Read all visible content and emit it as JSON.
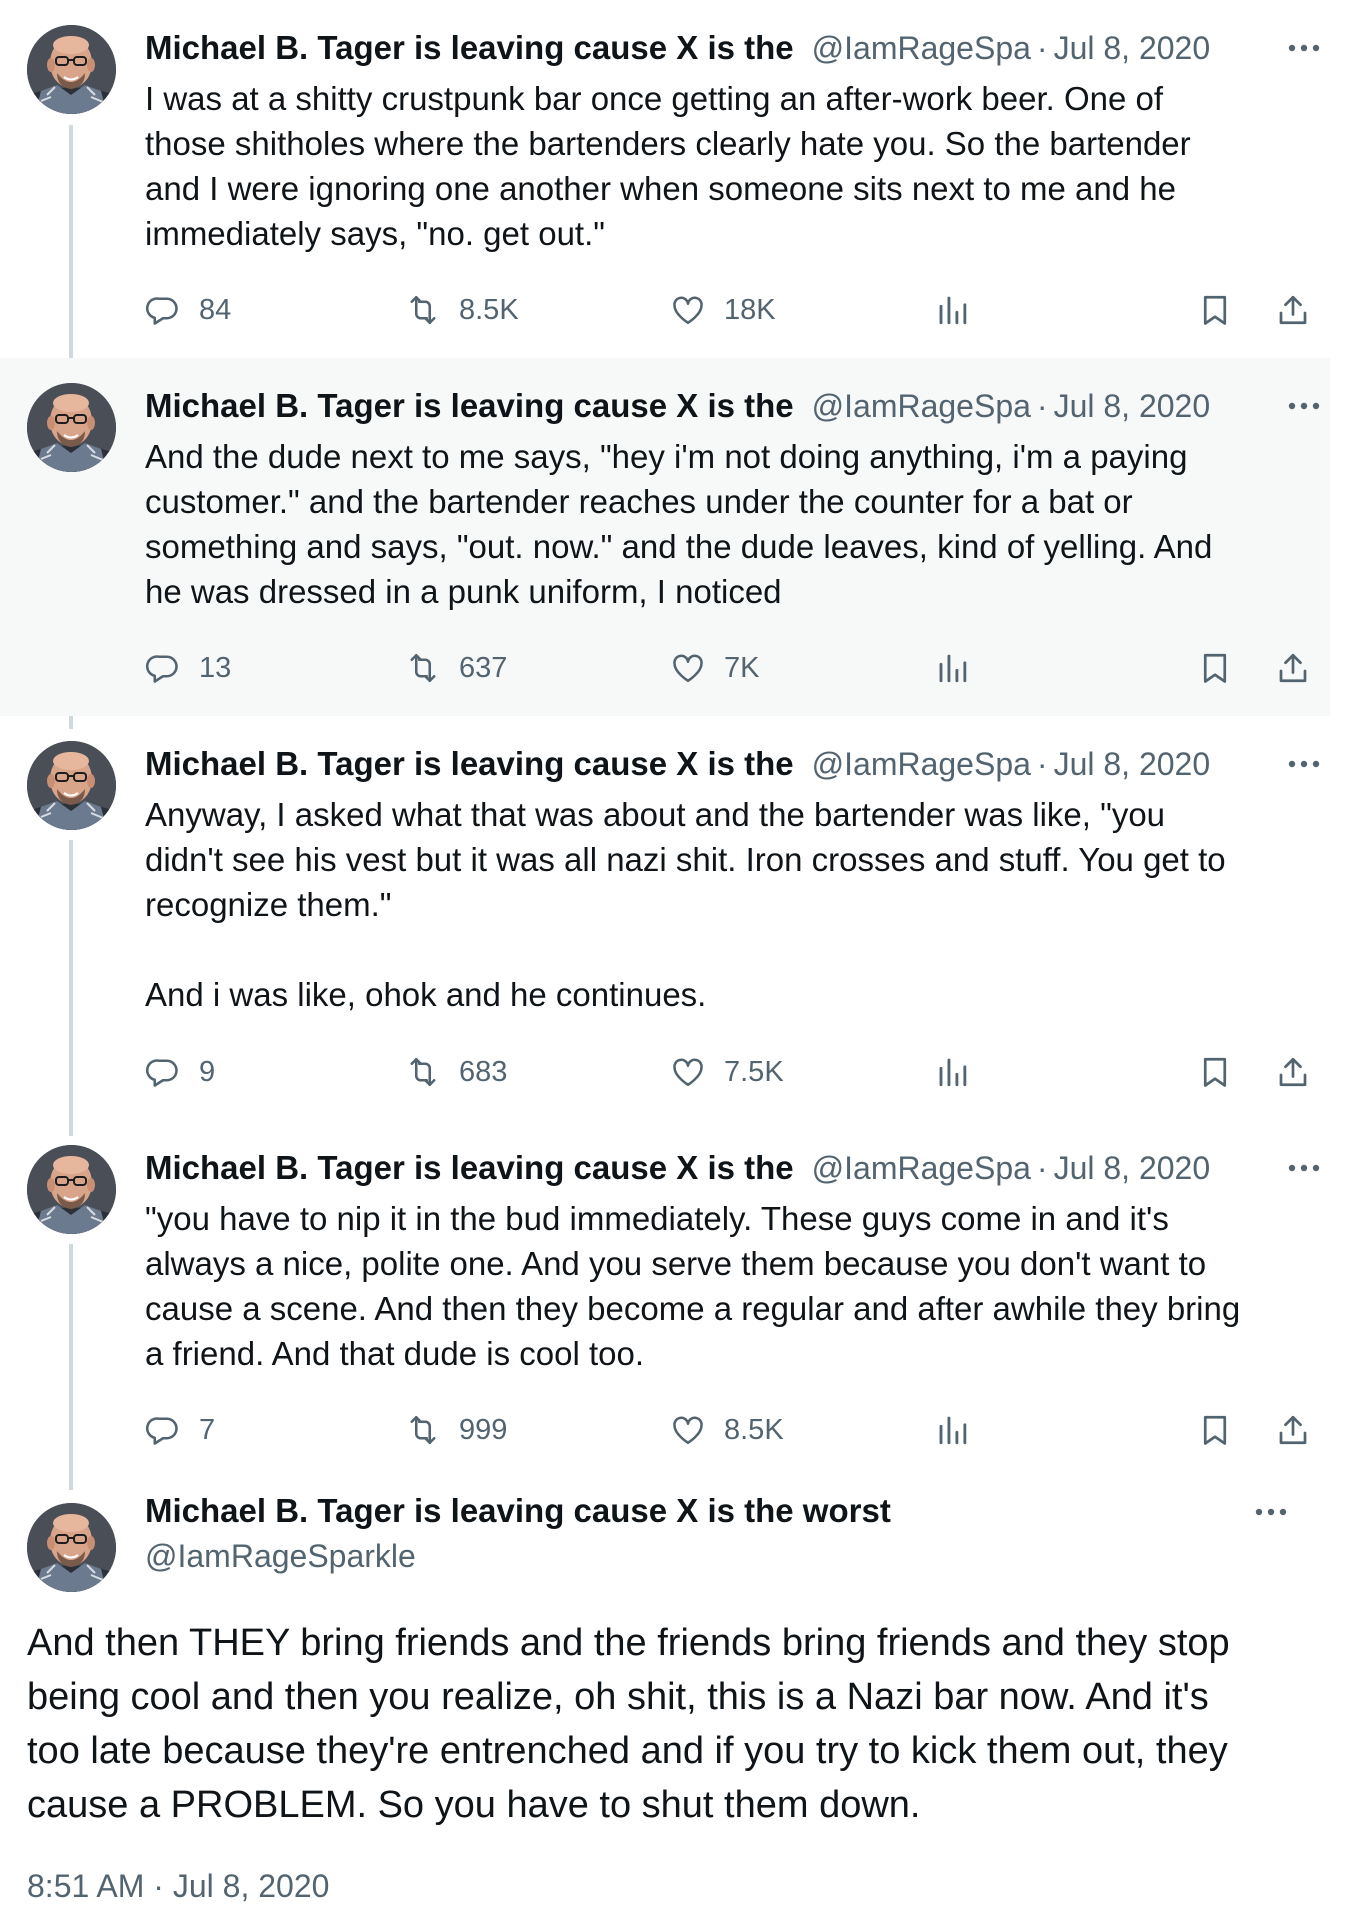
{
  "tweets": [
    {
      "name": "Michael B. Tager is leaving cause X is the",
      "handle": "@IamRageSpa",
      "date": "Jul 8, 2020",
      "text": "I was at a shitty crustpunk bar once getting an after-work beer. One of\nthose shitholes where the bartenders clearly hate you. So the bartender\nand I were ignoring one another when someone sits next to me and he\nimmediately says, \"no. get out.\"",
      "replies": "84",
      "reposts": "8.5K",
      "likes": "18K"
    },
    {
      "name": "Michael B. Tager is leaving cause X is the",
      "handle": "@IamRageSpa",
      "date": "Jul 8, 2020",
      "text": "And the dude next to me says, \"hey i'm not doing anything, i'm a paying\ncustomer.\" and the bartender reaches under the counter for a bat or\nsomething and says, \"out. now.\" and the dude leaves, kind of yelling. And\nhe was dressed in a punk uniform, I noticed",
      "replies": "13",
      "reposts": "637",
      "likes": "7K"
    },
    {
      "name": "Michael B. Tager is leaving cause X is the",
      "handle": "@IamRageSpa",
      "date": "Jul 8, 2020",
      "text": "Anyway, I asked what that was about and the bartender was like, \"you\ndidn't see his vest but it was all nazi shit. Iron crosses and stuff. You get to\nrecognize them.\"\n\nAnd i was like, ohok and he continues.",
      "replies": "9",
      "reposts": "683",
      "likes": "7.5K"
    },
    {
      "name": "Michael B. Tager is leaving cause X is the",
      "handle": "@IamRageSpa",
      "date": "Jul 8, 2020",
      "text": "\"you have to nip it in the bud immediately. These guys come in and it's\nalways a nice, polite one. And you serve them because you don't want to\ncause a scene. And then they become a regular and after awhile they bring\na friend. And that dude is cool too.",
      "replies": "7",
      "reposts": "999",
      "likes": "8.5K"
    }
  ],
  "main_tweet": {
    "name": "Michael B. Tager is leaving cause X is the worst",
    "handle": "@IamRageSparkle",
    "text": "And then THEY bring friends and the friends bring friends and they stop\nbeing cool and then you realize, oh shit, this is a Nazi bar now. And it's\ntoo late because they're entrenched and if you try to kick them out, they\ncause a PROBLEM. So you have to shut them down.",
    "timestamp": "8:51 AM · Jul 8, 2020"
  },
  "separator": "·",
  "icons": {
    "reply": "reply-icon",
    "repost": "repost-icon",
    "like": "heart-icon",
    "views": "views-icon",
    "bookmark": "bookmark-icon",
    "share": "share-icon",
    "more": "more-icon"
  },
  "colors": {
    "text": "#0f1419",
    "secondary": "#536471",
    "thread_line": "#cfd9de",
    "highlight_bg": "#f7f9f9"
  }
}
